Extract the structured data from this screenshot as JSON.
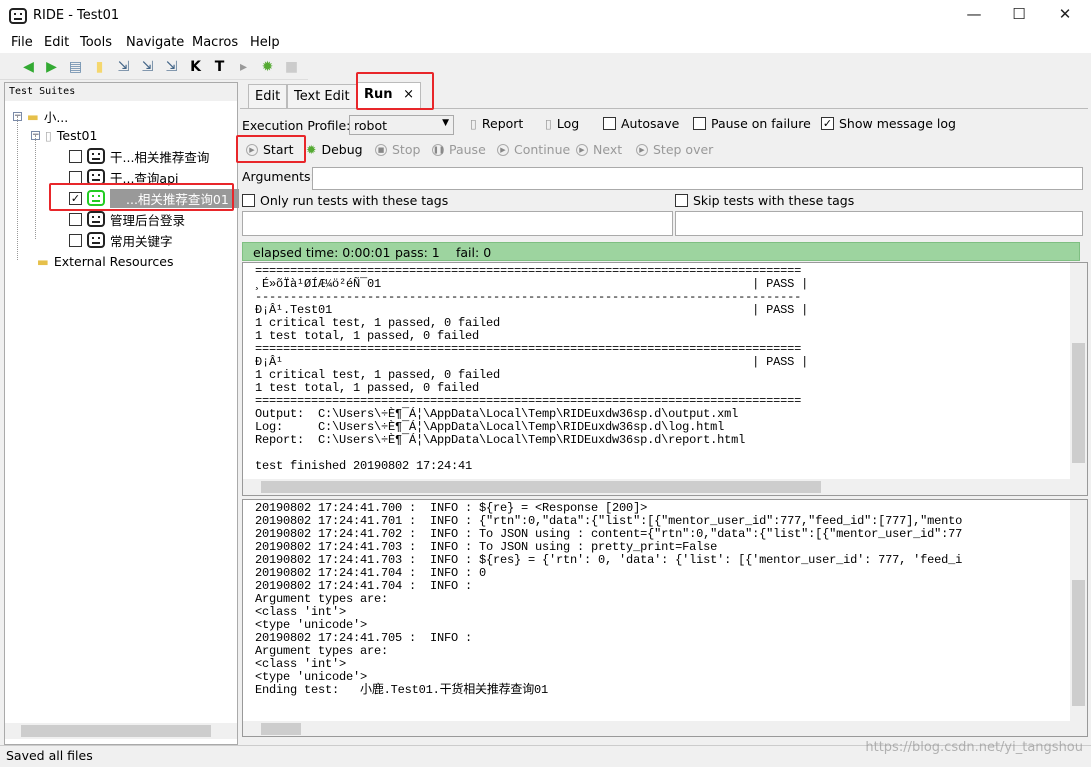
{
  "window": {
    "title": "RIDE - Test01",
    "minimize": "—",
    "maximize": "☐",
    "close": "✕"
  },
  "menu": [
    "File",
    "Edit",
    "Tools",
    "Navigate",
    "Macros",
    "Help"
  ],
  "toolbar": [
    {
      "icon": "back-arrow-icon",
      "glyph": "◀"
    },
    {
      "icon": "forward-arrow-icon",
      "glyph": "▶"
    },
    {
      "icon": "open-suite-icon",
      "glyph": "▤"
    },
    {
      "icon": "open-directory-icon",
      "glyph": "▮"
    },
    {
      "icon": "save-icon",
      "glyph": "⇲"
    },
    {
      "icon": "save-all-icon",
      "glyph": "⇲"
    },
    {
      "icon": "save-as-icon",
      "glyph": "⇲"
    },
    {
      "icon": "search-keywords-icon",
      "glyph": "K"
    },
    {
      "icon": "search-tests-icon",
      "glyph": "T"
    },
    {
      "icon": "run-icon",
      "glyph": "▸"
    },
    {
      "icon": "debug-bug-icon",
      "glyph": "✹"
    },
    {
      "icon": "stop-icon",
      "glyph": "■"
    }
  ],
  "tree": {
    "header": "Test Suites",
    "root": "小...",
    "suite": "Test01",
    "tests": [
      {
        "label": "干...相关推荐查询",
        "checked": false,
        "selected": false
      },
      {
        "label": "干...查询api",
        "checked": false,
        "selected": false
      },
      {
        "label": "...相关推荐查询01",
        "checked": true,
        "selected": true
      },
      {
        "label": "管理后台登录",
        "checked": false,
        "selected": false
      },
      {
        "label": "常用关键字",
        "checked": false,
        "selected": false
      }
    ],
    "external": "External Resources"
  },
  "tabs": [
    {
      "label": "Edit"
    },
    {
      "label": "Text Edit"
    },
    {
      "label": "Run",
      "active": true,
      "close": "×"
    }
  ],
  "run": {
    "profile_label": "Execution Profile:",
    "profile_value": "robot",
    "report": "Report",
    "log": "Log",
    "autosave": "Autosave",
    "autosave_checked": false,
    "pause_on_failure": "Pause on failure",
    "pause_checked": false,
    "show_message_log": "Show message log",
    "show_log_checked": true,
    "buttons": {
      "start": "Start",
      "debug": "Debug",
      "stop": "Stop",
      "pause": "Pause",
      "continue": "Continue",
      "next": "Next",
      "step_over": "Step over"
    },
    "arguments_label": "Arguments:",
    "arguments_value": "",
    "only_run_tags": "Only run tests with these tags",
    "skip_tags": "Skip tests with these tags",
    "elapsed": "elapsed time: 0:00:01",
    "pass": "pass: 1",
    "fail": "fail: 0",
    "status_color": "#9dd49f",
    "output": "==============================================================================\n¸É»õÏà¹ØÍÆ¼ö²éÑ¯01                                                     | PASS |\n------------------------------------------------------------------------------\nÐ¡Â¹.Test01                                                            | PASS |\n1 critical test, 1 passed, 0 failed\n1 test total, 1 passed, 0 failed\n==============================================================================\nÐ¡Â¹                                                                   | PASS |\n1 critical test, 1 passed, 0 failed\n1 test total, 1 passed, 0 failed\n==============================================================================\nOutput:  C:\\Users\\÷È¶¯Á¦\\AppData\\Local\\Temp\\RIDEuxdw36sp.d\\output.xml\nLog:     C:\\Users\\÷È¶¯Á¦\\AppData\\Local\\Temp\\RIDEuxdw36sp.d\\log.html\nReport:  C:\\Users\\÷È¶¯Á¦\\AppData\\Local\\Temp\\RIDEuxdw36sp.d\\report.html\n\ntest finished 20190802 17:24:41",
    "message_log": "20190802 17:24:41.700 :  INFO : ${re} = <Response [200]>\n20190802 17:24:41.701 :  INFO : {\"rtn\":0,\"data\":{\"list\":[{\"mentor_user_id\":777,\"feed_id\":[777],\"mento\n20190802 17:24:41.702 :  INFO : To JSON using : content={\"rtn\":0,\"data\":{\"list\":[{\"mentor_user_id\":77\n20190802 17:24:41.703 :  INFO : To JSON using : pretty_print=False\n20190802 17:24:41.703 :  INFO : ${res} = {'rtn': 0, 'data': {'list': [{'mentor_user_id': 777, 'feed_i\n20190802 17:24:41.704 :  INFO : 0\n20190802 17:24:41.704 :  INFO :\nArgument types are:\n<class 'int'>\n<type 'unicode'>\n20190802 17:24:41.705 :  INFO :\nArgument types are:\n<class 'int'>\n<type 'unicode'>\nEnding test:   小鹿.Test01.干货相关推荐查询01"
  },
  "statusbar": "Saved all files",
  "watermark": "https://blog.csdn.net/yi_tangshou"
}
